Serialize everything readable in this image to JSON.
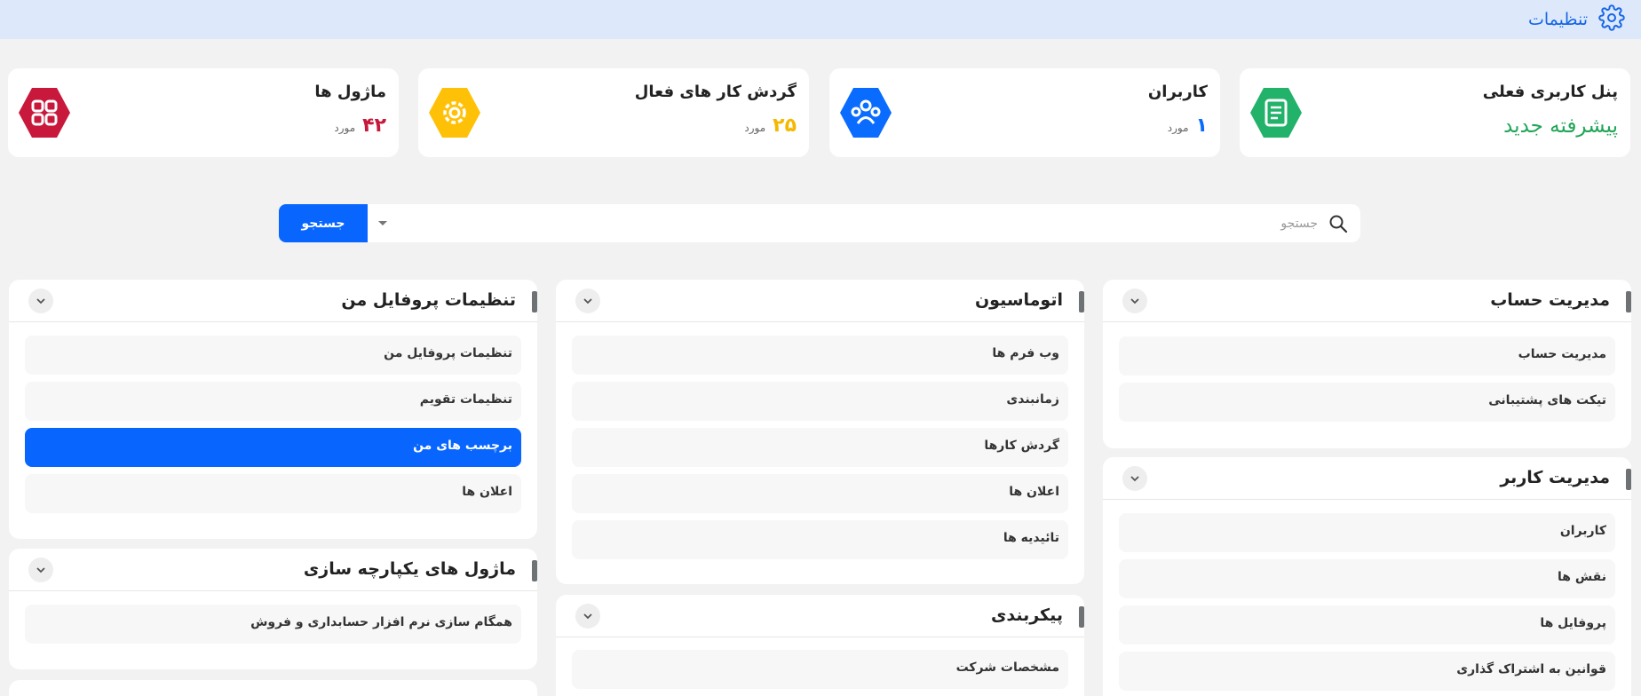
{
  "header": {
    "title": "تنظیمات",
    "icon": "gear-icon",
    "accent": "#1766e6"
  },
  "cards": [
    {
      "title": "پنل کاربری فعلی",
      "value": "پیشرفته جدید",
      "icon": "document-icon",
      "color": "#22b26a"
    },
    {
      "title": "کاربران",
      "value": "۱",
      "unit": "مورد",
      "icon": "users-icon",
      "color": "#0a6cff"
    },
    {
      "title": "گردش کار های فعال",
      "value": "۲۵",
      "unit": "مورد",
      "icon": "gear-icon",
      "color": "#ffc107"
    },
    {
      "title": "ماژول ها",
      "value": "۴۲",
      "unit": "مورد",
      "icon": "grid-icon",
      "color": "#c8183c"
    }
  ],
  "search": {
    "placeholder": "جستجو",
    "button_label": "جستجو"
  },
  "panels": {
    "account_management": {
      "title": "مدیریت حساب",
      "items": [
        "مدیریت حساب",
        "تیکت های پشتیبانی"
      ]
    },
    "user_management": {
      "title": "مدیریت کاربر",
      "items": [
        "کاربران",
        "نقش ها",
        "پروفایل ها",
        "قوانین به اشتراک گذاری"
      ]
    },
    "automation": {
      "title": "اتوماسیون",
      "items": [
        "وب فرم ها",
        "زمانبندی",
        "گردش کارها",
        "اعلان ها",
        "تائیدیه ها"
      ]
    },
    "configuration": {
      "title": "پیکربندی",
      "items": [
        "مشخصات شرکت"
      ]
    },
    "profile_settings": {
      "title": "تنظیمات پروفایل من",
      "items": [
        "تنظیمات پروفایل من",
        "تنظیمات تقویم",
        "برچسب های من",
        "اعلان ها"
      ],
      "active_item": "برچسب های من"
    },
    "integration_modules": {
      "title": "ماژول های یکپارچه سازی",
      "items": [
        "همگام سازی نرم افزار حسابداری و فروش"
      ]
    }
  }
}
